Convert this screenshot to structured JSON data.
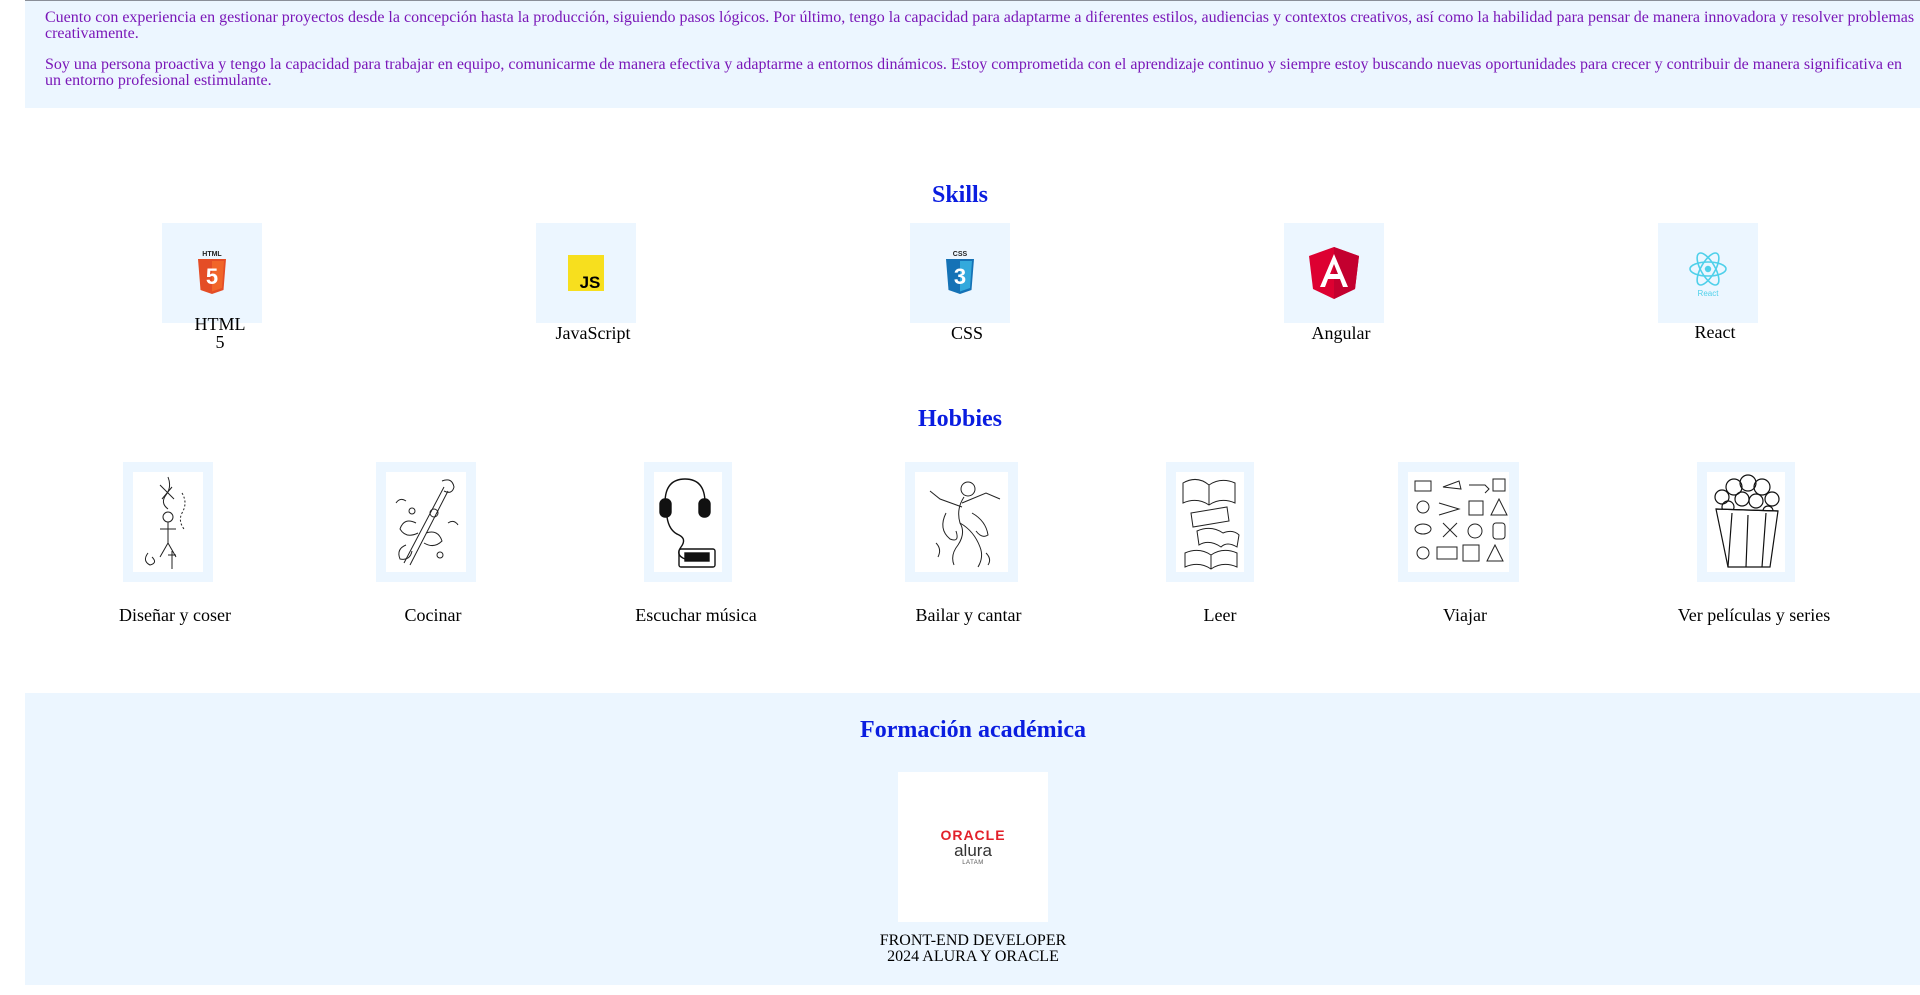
{
  "about": {
    "p1": "Cuento con experiencia en gestionar proyectos desde la concepción hasta la producción, siguiendo pasos lógicos. Por último, tengo la capacidad para adaptarme a diferentes estilos, audiencias y contextos creativos, así como la habilidad para pensar de manera innovadora y resolver problemas creativamente.",
    "p2": "Soy una persona proactiva y tengo la capacidad para trabajar en equipo, comunicarme de manera efectiva y adaptarme a entornos dinámicos. Estoy comprometida con el aprendizaje continuo y siempre estoy buscando nuevas oportunidades para crecer y contribuir de manera significativa en un entorno profesional estimulante."
  },
  "skills": {
    "title": "Skills",
    "items": [
      {
        "label_line1": "HTML",
        "label_line2": "5",
        "logo_text": "HTML",
        "icon": "html5-icon",
        "color": "#e44d26"
      },
      {
        "label": "JavaScript",
        "logo_text": "JS",
        "icon": "javascript-icon",
        "color": "#f7df1e"
      },
      {
        "label": "CSS",
        "logo_text": "CSS",
        "icon": "css3-icon",
        "color": "#1572b6"
      },
      {
        "label": "Angular",
        "icon": "angular-icon",
        "color": "#dd0031"
      },
      {
        "label": "React",
        "logo_text": "React",
        "icon": "react-icon",
        "color": "#61dafb"
      }
    ]
  },
  "hobbies": {
    "title": "Hobbies",
    "items": [
      {
        "label": "Diseñar y coser",
        "icon": "sewing-sketch-icon"
      },
      {
        "label": "Cocinar",
        "icon": "cooking-sketch-icon"
      },
      {
        "label": "Escuchar música",
        "icon": "headphones-sketch-icon"
      },
      {
        "label": "Bailar y cantar",
        "icon": "dancer-sketch-icon"
      },
      {
        "label": "Leer",
        "icon": "books-sketch-icon"
      },
      {
        "label": "Viajar",
        "icon": "travel-sketch-icon"
      },
      {
        "label": "Ver películas y series",
        "icon": "popcorn-sketch-icon"
      }
    ]
  },
  "formacion": {
    "title": "Formación académica",
    "logo": {
      "oracle": "ORACLE",
      "alura": "alura",
      "latam": "LATAM"
    },
    "cert_line1": "FRONT-END DEVELOPER",
    "cert_line2": "2024 ALURA Y ORACLE"
  }
}
